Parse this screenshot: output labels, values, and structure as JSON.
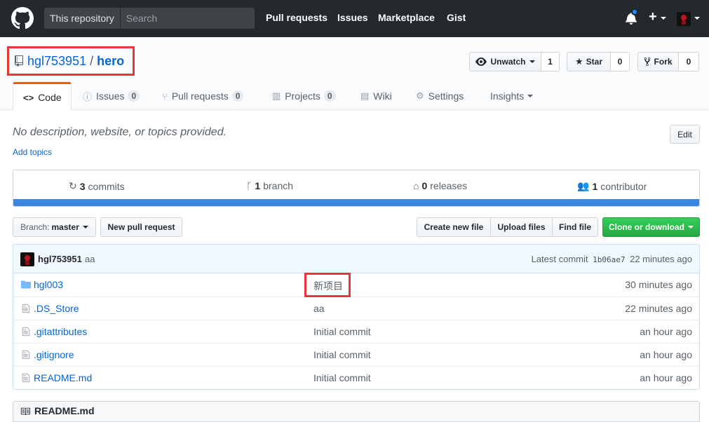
{
  "header": {
    "scope": "This repository",
    "search_placeholder": "Search",
    "nav": [
      "Pull requests",
      "Issues",
      "Marketplace",
      "Gist"
    ]
  },
  "repo": {
    "owner": "hgl753951",
    "separator": "/",
    "name": "hero",
    "watch_label": "Unwatch",
    "watch_count": "1",
    "star_label": "Star",
    "star_count": "0",
    "fork_label": "Fork",
    "fork_count": "0"
  },
  "tabs": {
    "code": "Code",
    "issues": "Issues",
    "issues_count": "0",
    "pulls": "Pull requests",
    "pulls_count": "0",
    "projects": "Projects",
    "projects_count": "0",
    "wiki": "Wiki",
    "settings": "Settings",
    "insights": "Insights"
  },
  "description": {
    "text": "No description, website, or topics provided.",
    "add_topics": "Add topics",
    "edit": "Edit"
  },
  "summary": {
    "commits_num": "3",
    "commits_label": "commits",
    "branch_num": "1",
    "branch_label": "branch",
    "releases_num": "0",
    "releases_label": "releases",
    "contributor_num": "1",
    "contributor_label": "contributor"
  },
  "file_nav": {
    "branch_label": "Branch:",
    "branch_value": "master",
    "new_pr": "New pull request",
    "create_file": "Create new file",
    "upload_files": "Upload files",
    "find_file": "Find file",
    "clone": "Clone or download"
  },
  "commit_tease": {
    "author": "hgl753951",
    "message": "aa",
    "latest_label": "Latest commit",
    "sha": "1b06ae7",
    "age": "22 minutes ago"
  },
  "files": [
    {
      "type": "dir",
      "name": "hgl003",
      "message": "新项目",
      "age": "30 minutes ago"
    },
    {
      "type": "file",
      "name": ".DS_Store",
      "message": "aa",
      "age": "22 minutes ago"
    },
    {
      "type": "file",
      "name": ".gitattributes",
      "message": "Initial commit",
      "age": "an hour ago"
    },
    {
      "type": "file",
      "name": ".gitignore",
      "message": "Initial commit",
      "age": "an hour ago"
    },
    {
      "type": "file",
      "name": "README.md",
      "message": "Initial commit",
      "age": "an hour ago"
    }
  ],
  "readme": {
    "title": "README.md"
  },
  "colors": {
    "header_bg": "#24292e",
    "link": "#0366d6",
    "clone_green": "#28a745",
    "annotation_red": "#e5383b",
    "language_bar": "#3b87e0"
  }
}
